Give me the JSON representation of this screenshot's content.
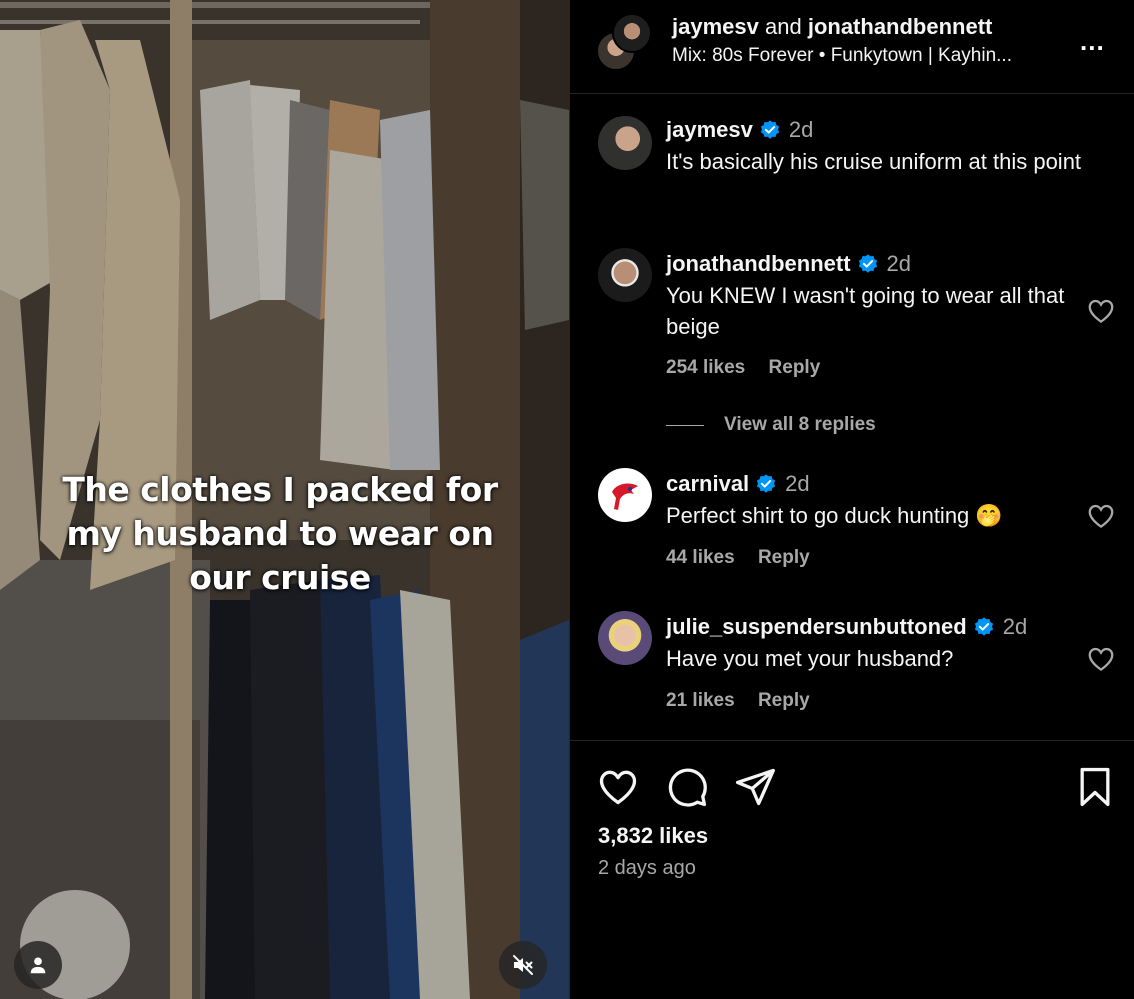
{
  "video": {
    "caption": "The clothes I packed for\nmy husband to wear on\nour cruise",
    "user_icon": "person-icon",
    "mute_icon": "muted-speaker-icon"
  },
  "header": {
    "user1": "jaymesv",
    "conjunction": "and",
    "user2": "jonathandbennett",
    "music": "Mix: 80s Forever • Funkytown | Kayhin...",
    "more_icon": "more-options-icon",
    "more_label": "..."
  },
  "comments": [
    {
      "username": "jaymesv",
      "verified": true,
      "time": "2d",
      "text": "It's basically his cruise uniform at this point"
    },
    {
      "username": "jonathandbennett",
      "verified": true,
      "time": "2d",
      "text": "You KNEW I wasn't going to wear all that beige",
      "likes": "254 likes",
      "reply": "Reply",
      "view_replies": "View all 8 replies"
    },
    {
      "username": "carnival",
      "verified": true,
      "time": "2d",
      "text": "Perfect shirt to go duck hunting 🤭",
      "likes": "44 likes",
      "reply": "Reply"
    },
    {
      "username": "julie_suspendersunbuttoned",
      "verified": true,
      "time": "2d",
      "text": "Have you met your husband?",
      "likes": "21 likes",
      "reply": "Reply"
    }
  ],
  "footer": {
    "likes": "3,832 likes",
    "posted": "2 days ago",
    "icons": [
      "heart-icon",
      "comment-icon",
      "share-icon",
      "bookmark-icon"
    ]
  },
  "colors": {
    "background": "#000000",
    "text_primary": "#f5f5f5",
    "text_secondary": "#a8a8a8",
    "verified_blue": "#0095f6",
    "carnival_red": "#d7182a"
  }
}
